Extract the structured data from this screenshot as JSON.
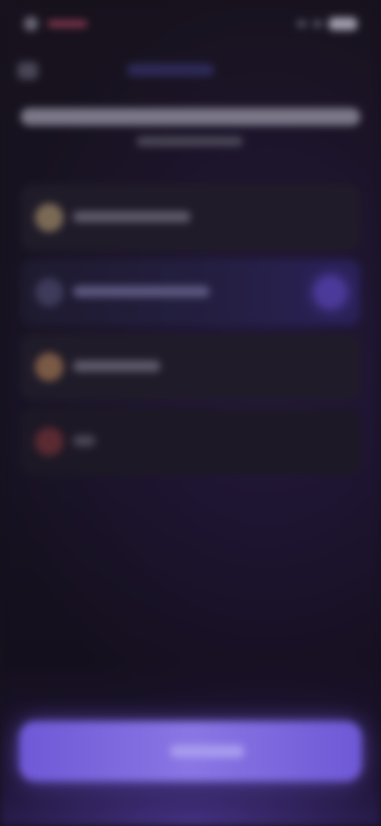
{
  "screen": {
    "accent_color": "#7a63dc",
    "background_color": "#17121d"
  },
  "status_bar": {
    "icons": [
      "status-dot-icon",
      "signal-icon",
      "wifi-icon",
      "battery-icon"
    ]
  },
  "header": {
    "back_icon": "chevron-left-icon"
  },
  "options": {
    "items": [
      {
        "icon": "circle-icon",
        "icon_color": "#7a6a55",
        "selected": false
      },
      {
        "icon": "circle-icon",
        "icon_color": "#3d3a5a",
        "selected": true
      },
      {
        "icon": "circle-icon",
        "icon_color": "#7a5a45",
        "selected": false
      },
      {
        "icon": "circle-icon",
        "icon_color": "#5a2a32",
        "selected": false
      }
    ]
  },
  "cta": {
    "color": "#7a63dc"
  }
}
